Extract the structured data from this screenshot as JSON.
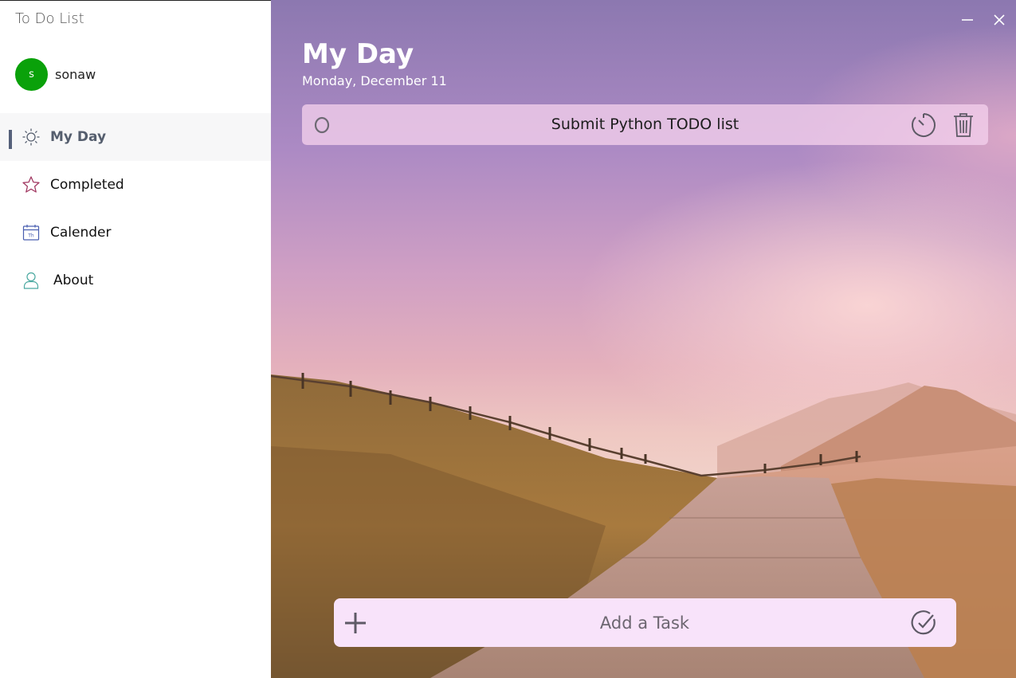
{
  "app": {
    "title": "To Do List"
  },
  "user": {
    "initial": "s",
    "name": "sonaw",
    "avatar_color": "#0aa10a"
  },
  "nav": {
    "items": [
      {
        "id": "my-day",
        "label": "My Day",
        "icon": "sun-icon",
        "active": true
      },
      {
        "id": "completed",
        "label": "Completed",
        "icon": "star-icon",
        "active": false
      },
      {
        "id": "calender",
        "label": "Calender",
        "icon": "calendar-icon",
        "active": false
      },
      {
        "id": "about",
        "label": "About",
        "icon": "person-icon",
        "active": false
      }
    ],
    "calendar_icon_text": "Th"
  },
  "window": {
    "minimize_icon": "minimize-icon",
    "close_icon": "close-icon"
  },
  "main": {
    "title": "My Day",
    "date": "Monday, December 11",
    "tasks": [
      {
        "text": "Submit Python TODO list",
        "check_symbol": "O",
        "timer_icon": "timer-icon",
        "delete_icon": "trash-icon"
      }
    ],
    "add_task": {
      "placeholder": "Add a Task",
      "add_icon": "plus-icon",
      "confirm_icon": "check-circle-icon"
    }
  },
  "colors": {
    "accent": "#55607a",
    "task_card": "#f4d0ec",
    "add_bar": "#f8e3fa",
    "avatar": "#0aa10a"
  }
}
